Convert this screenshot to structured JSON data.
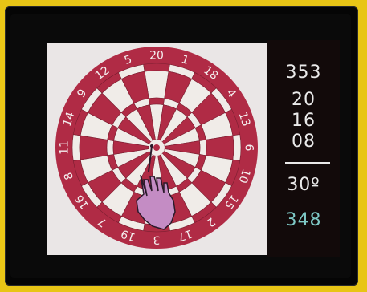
{
  "dartboard": {
    "numbers": [
      "20",
      "1",
      "18",
      "4",
      "13",
      "6",
      "10",
      "15",
      "2",
      "17",
      "3",
      "19",
      "7",
      "16",
      "8",
      "11",
      "14",
      "9",
      "12",
      "5"
    ],
    "colors": {
      "ring": "#b02b45",
      "light": "#f0ece8",
      "background": "#eae6e6",
      "hand": "#c48cc4"
    }
  },
  "scoreboard": {
    "total": "353",
    "throws": [
      "20",
      "16",
      "08"
    ],
    "round_score": "30º",
    "remaining": "348",
    "colors": {
      "text": "#e9e9e9",
      "remaining": "#7ec9c6"
    }
  }
}
